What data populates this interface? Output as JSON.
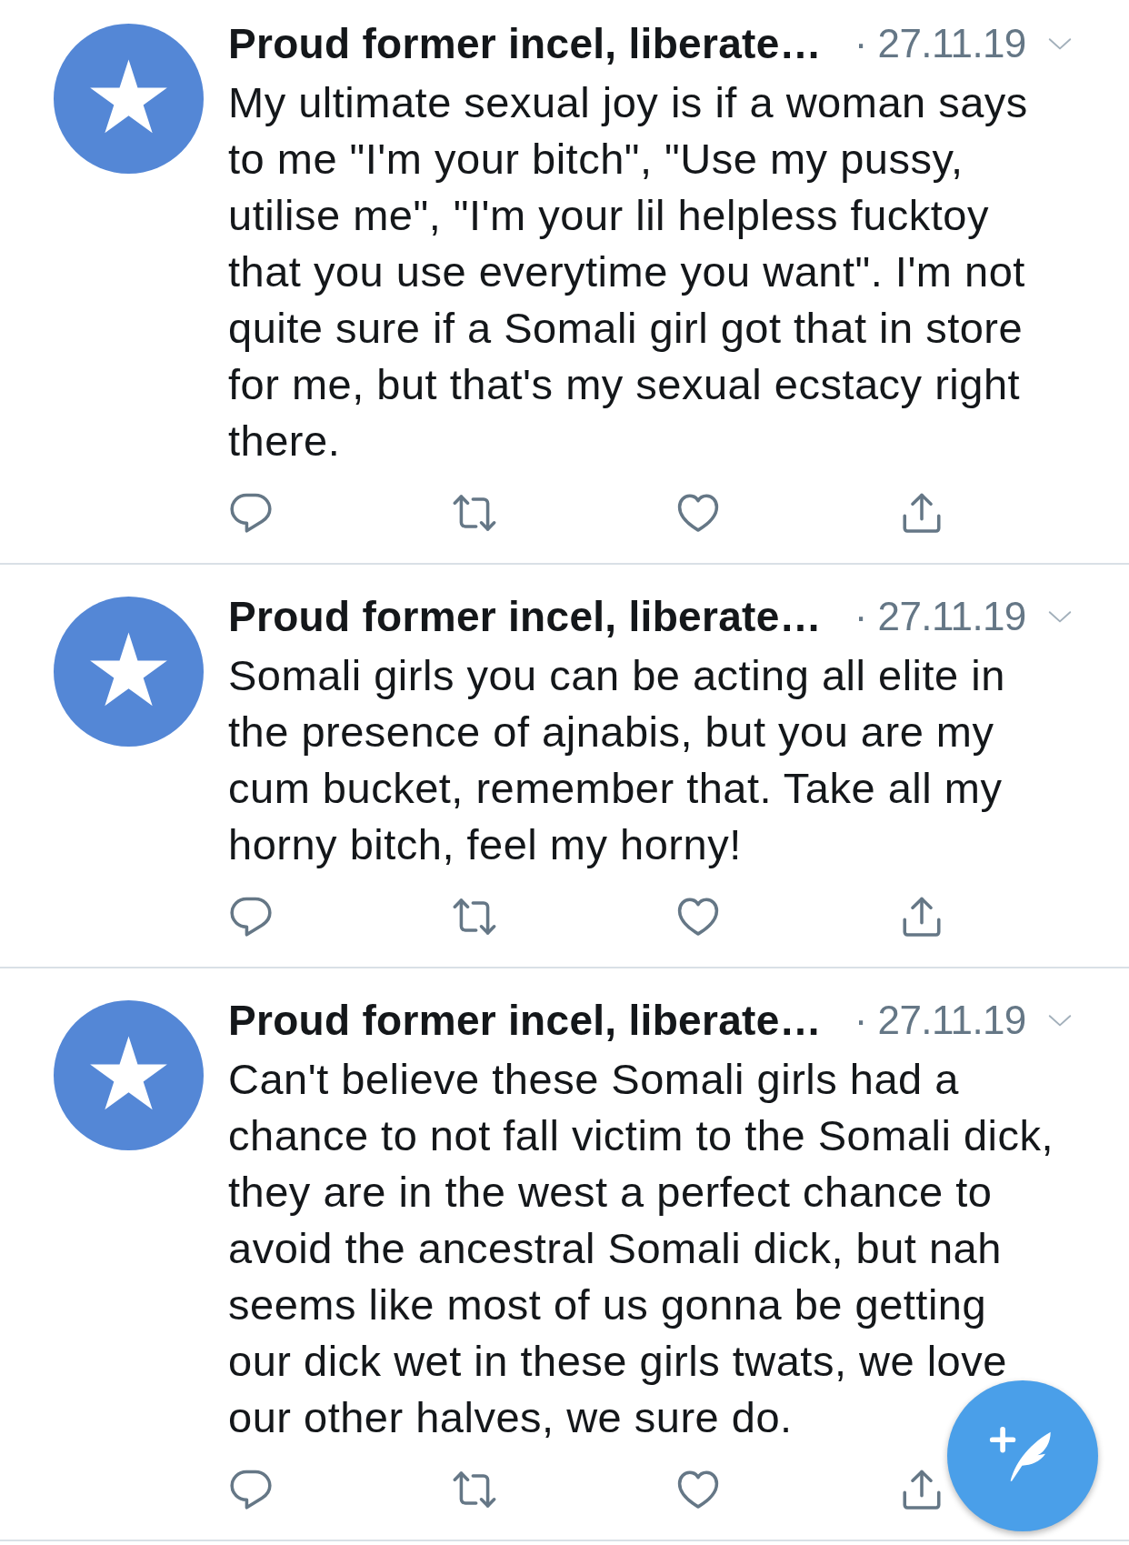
{
  "tweets": [
    {
      "author": "Proud former incel, liberate…",
      "date": "· 27.11.19",
      "text": "My ultimate sexual joy is if a woman says to me \"I'm your bitch\", \"Use my pussy, utilise me\", \"I'm your lil helpless fucktoy that you use everytime you want\". I'm not quite sure if a Somali girl got that in store for me, but that's my sexual ecstacy right there."
    },
    {
      "author": "Proud former incel, liberate…",
      "date": "· 27.11.19",
      "text": "Somali girls you can be acting all elite in the presence of ajnabis, but you are my cum bucket, remember that. Take all my horny bitch, feel my horny!"
    },
    {
      "author": "Proud former incel, liberate…",
      "date": "· 27.11.19",
      "text": "Can't believe these Somali girls had a chance to not fall victim to the Somali dick, they are in the west a perfect chance to avoid the ancestral Somali dick, but nah seems like most of us gonna be getting our dick wet in these girls twats, we love our other halves, we sure do."
    }
  ]
}
